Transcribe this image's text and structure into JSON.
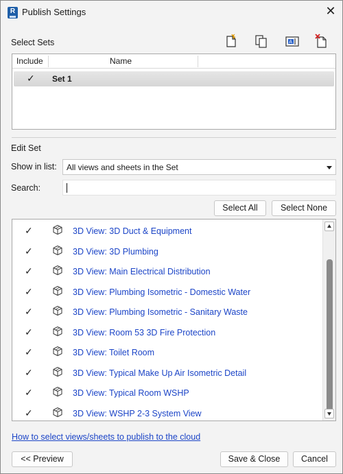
{
  "window": {
    "title": "Publish Settings",
    "app_icon_letter": "R",
    "close_symbol": "✕"
  },
  "select_sets": {
    "label": "Select Sets",
    "toolbar_icons": [
      "new-set-icon",
      "duplicate-set-icon",
      "rename-set-icon",
      "delete-set-icon"
    ],
    "columns": [
      "Include",
      "Name"
    ],
    "rows": [
      {
        "included": true,
        "check": "✓",
        "name": "Set 1"
      }
    ]
  },
  "edit_set": {
    "label": "Edit Set",
    "show_in_list_label": "Show in list:",
    "show_in_list_value": "All views and sheets in the Set",
    "search_label": "Search:",
    "search_value": "",
    "select_all": "Select All",
    "select_none": "Select None"
  },
  "views": [
    {
      "check": "✓",
      "label": "3D View: 3D Duct & Equipment"
    },
    {
      "check": "✓",
      "label": "3D View: 3D Plumbing"
    },
    {
      "check": "✓",
      "label": "3D View: Main Electrical Distribution"
    },
    {
      "check": "✓",
      "label": "3D View: Plumbing Isometric - Domestic Water"
    },
    {
      "check": "✓",
      "label": "3D View: Plumbing Isometric - Sanitary Waste"
    },
    {
      "check": "✓",
      "label": "3D View: Room 53 3D Fire Protection"
    },
    {
      "check": "✓",
      "label": "3D View: Toilet Room"
    },
    {
      "check": "✓",
      "label": "3D View: Typical Make Up Air Isometric Detail"
    },
    {
      "check": "✓",
      "label": "3D View: Typical Room WSHP"
    },
    {
      "check": "✓",
      "label": "3D View: WSHP 2-3 System View"
    }
  ],
  "help_link": "How to select views/sheets to publish to the cloud",
  "footer": {
    "preview": "<< Preview",
    "save_close": "Save & Close",
    "cancel": "Cancel"
  },
  "colors": {
    "link": "#1c45c7",
    "background": "#f3f3f3"
  }
}
